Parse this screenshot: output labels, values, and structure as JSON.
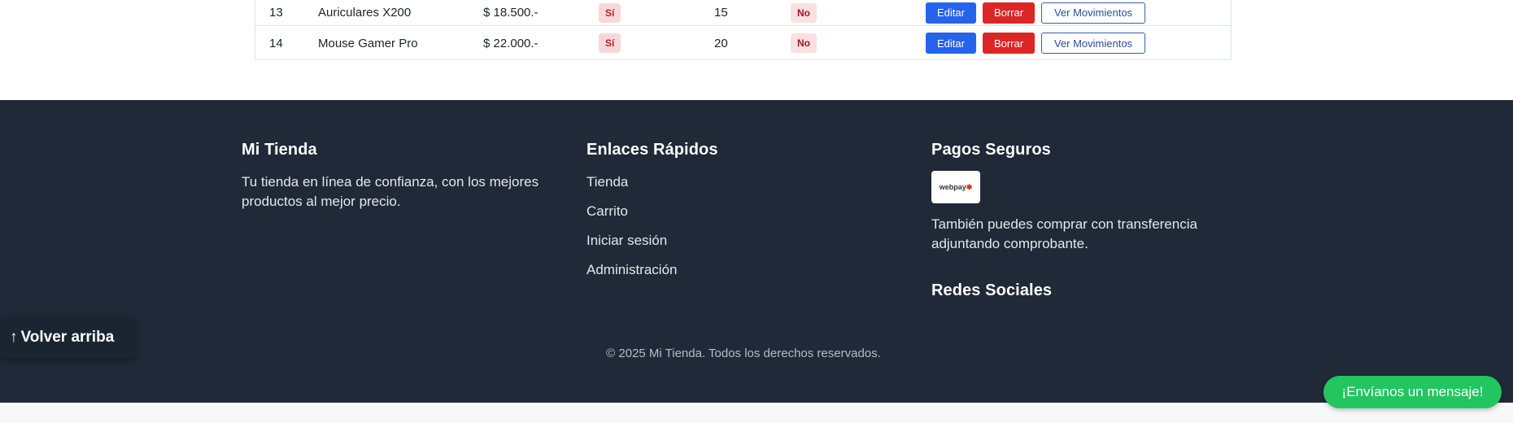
{
  "table": {
    "rows": [
      {
        "id": "13",
        "name": "Auriculares X200",
        "price": "$ 18.500.-",
        "flag1": "Sí",
        "stock": "15",
        "flag2": "No",
        "edit": "Editar",
        "delete": "Borrar",
        "movements": "Ver Movimientos"
      },
      {
        "id": "14",
        "name": "Mouse Gamer Pro",
        "price": "$ 22.000.-",
        "flag1": "Sí",
        "stock": "20",
        "flag2": "No",
        "edit": "Editar",
        "delete": "Borrar",
        "movements": "Ver Movimientos"
      }
    ]
  },
  "footer": {
    "col1": {
      "title": "Mi Tienda",
      "description": "Tu tienda en línea de confianza, con los mejores productos al mejor precio."
    },
    "col2": {
      "title": "Enlaces Rápidos",
      "links": [
        "Tienda",
        "Carrito",
        "Iniciar sesión",
        "Administración"
      ]
    },
    "col3": {
      "title": "Pagos Seguros",
      "payment_logo": "webpay-logo",
      "transfer_text": "También puedes comprar con transferencia adjuntando comprobante.",
      "social_title": "Redes Sociales"
    },
    "copyright": "© 2025 Mi Tienda. Todos los derechos reservados."
  },
  "back_to_top": {
    "arrow": "↑",
    "label": "Volver arriba"
  },
  "chat": {
    "label": "¡Envíanos un mensaje!"
  },
  "colors": {
    "footer_bg": "#1f2937",
    "edit": "#2563eb",
    "delete": "#dc2626",
    "chat": "#22c55e"
  }
}
